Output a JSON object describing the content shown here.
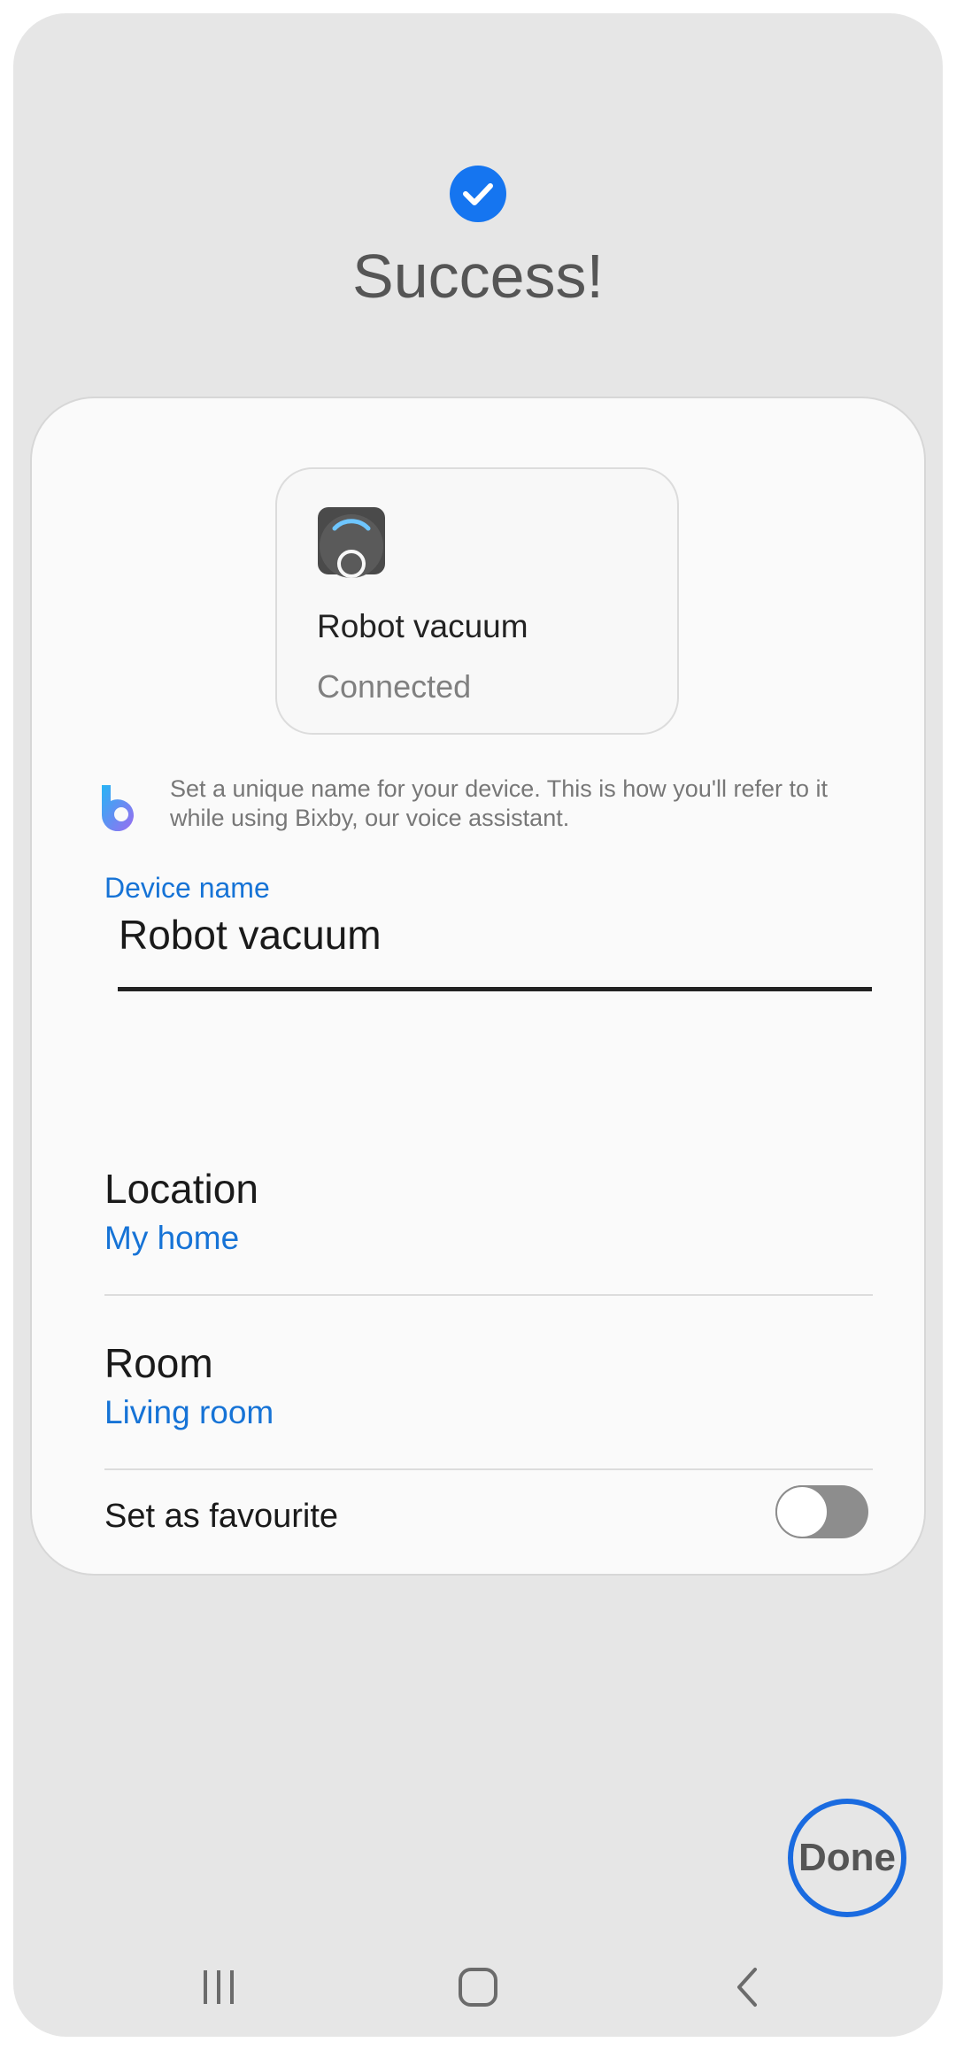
{
  "header": {
    "title": "Success!",
    "icon": "check-circle-icon",
    "accent_color": "#1575f0"
  },
  "device": {
    "name": "Robot vacuum",
    "status": "Connected",
    "icon": "robot-vacuum-icon"
  },
  "bixby": {
    "icon": "bixby-icon",
    "text": "Set a unique name for your device. This is how you'll refer to it while using Bixby, our voice assistant."
  },
  "device_name_field": {
    "label": "Device name",
    "value": "Robot vacuum"
  },
  "location": {
    "title": "Location",
    "value": "My home"
  },
  "room": {
    "title": "Room",
    "value": "Living room"
  },
  "favourite": {
    "label": "Set as favourite",
    "enabled": false
  },
  "done_button": {
    "label": "Done"
  },
  "navbar": {
    "recents_icon": "recents-icon",
    "home_icon": "home-icon",
    "back_icon": "back-icon"
  }
}
